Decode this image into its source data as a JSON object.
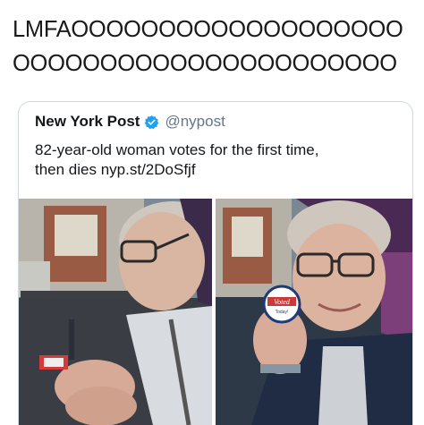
{
  "caption": {
    "line1": "LMFAOOOOOOOOOOOOOOOOOOO",
    "line2": "OOOOOOOOOOOOOOOOOOOOOO"
  },
  "tweet": {
    "author_name": "New York Post",
    "handle": "@nypost",
    "text_line1": "82-year-old woman votes for the first time,",
    "text_line2": "then dies nyp.st/2DoSfjf",
    "sticker_text": "Voted",
    "sticker_sub": "Today!"
  },
  "colors": {
    "verified": "#1da1f2",
    "handle": "#657786",
    "border": "#cfd9de"
  },
  "icons": {
    "verified": "verified-badge-icon"
  }
}
